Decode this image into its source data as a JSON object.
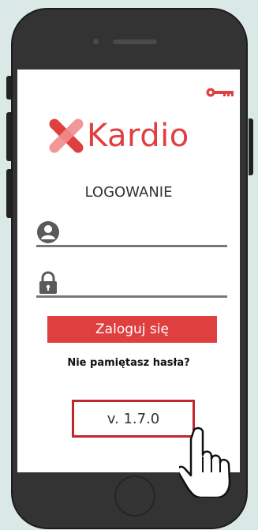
{
  "header": {
    "key_icon": "key-icon"
  },
  "logo": {
    "text": "Kardio",
    "brand_color": "#e03f40"
  },
  "login": {
    "title": "LOGOWANIE",
    "username": {
      "icon": "user-icon",
      "value": "",
      "placeholder": ""
    },
    "password": {
      "icon": "lock-icon",
      "value": "",
      "placeholder": ""
    },
    "submit_label": "Zaloguj się",
    "forgot_label": "Nie pamiętasz hasła?"
  },
  "version": {
    "label": "v. 1.7.0",
    "highlight_color": "#c0272d"
  },
  "cursor": {
    "icon": "hand-pointer-icon"
  }
}
